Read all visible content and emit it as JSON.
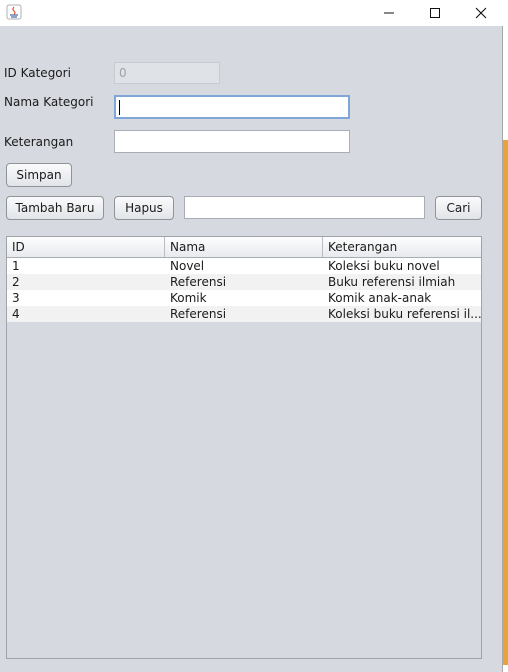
{
  "window": {
    "icon": "java-app-icon",
    "controls": {
      "minimize": "minimize-icon",
      "maximize": "maximize-icon",
      "close": "close-icon"
    }
  },
  "form": {
    "id_label": "ID Kategori",
    "id_value": "0",
    "nama_label": "Nama Kategori",
    "nama_value": "",
    "keterangan_label": "Keterangan",
    "keterangan_value": ""
  },
  "buttons": {
    "simpan": "Simpan",
    "tambah_baru": "Tambah Baru",
    "hapus": "Hapus",
    "cari": "Cari"
  },
  "search": {
    "value": ""
  },
  "table": {
    "columns": [
      "ID",
      "Nama",
      "Keterangan"
    ],
    "rows": [
      [
        "1",
        "Novel",
        "Koleksi buku novel"
      ],
      [
        "2",
        "Referensi",
        "Buku referensi ilmiah"
      ],
      [
        "3",
        "Komik",
        "Komik anak-anak"
      ],
      [
        "4",
        "Referensi",
        "Koleksi buku referensi il..."
      ]
    ]
  }
}
